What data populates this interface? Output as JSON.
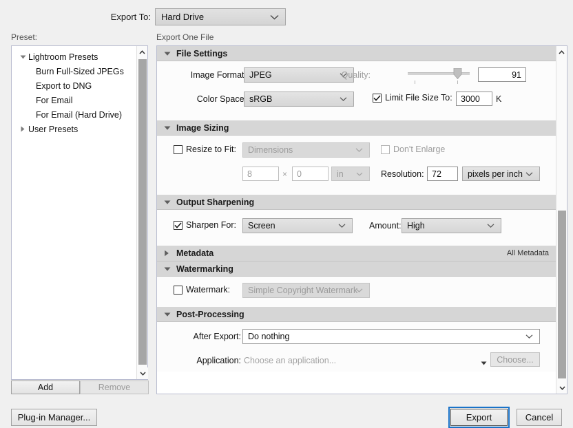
{
  "header": {
    "export_to_label": "Export To:",
    "export_to_value": "Hard Drive",
    "preset_label": "Preset:",
    "export_one_file": "Export One File"
  },
  "presets": {
    "tree": [
      {
        "label": "Lightroom Presets",
        "level": 0,
        "expanded": true
      },
      {
        "label": "Burn Full-Sized JPEGs",
        "level": 1,
        "expanded": null
      },
      {
        "label": "Export to DNG",
        "level": 1,
        "expanded": null
      },
      {
        "label": "For Email",
        "level": 1,
        "expanded": null
      },
      {
        "label": "For Email (Hard Drive)",
        "level": 1,
        "expanded": null
      },
      {
        "label": "User Presets",
        "level": 0,
        "expanded": false
      }
    ],
    "add_button": "Add",
    "remove_button": "Remove"
  },
  "sections": {
    "file_settings": {
      "title": "File Settings",
      "image_format_label": "Image Format:",
      "image_format_value": "JPEG",
      "color_space_label": "Color Space:",
      "color_space_value": "sRGB",
      "quality_label": "Quality:",
      "quality_value": "91",
      "quality_percent": 80,
      "limit_file_size_label": "Limit File Size To:",
      "limit_file_size_checked": true,
      "limit_file_size_value": "3000",
      "limit_file_size_unit": "K"
    },
    "image_sizing": {
      "title": "Image Sizing",
      "resize_to_fit_label": "Resize to Fit:",
      "resize_to_fit_checked": false,
      "resize_mode_value": "Dimensions",
      "dont_enlarge_label": "Don't Enlarge",
      "dont_enlarge_checked": false,
      "width_value": "8",
      "times_symbol": "×",
      "height_value": "0",
      "unit_value": "in",
      "resolution_label": "Resolution:",
      "resolution_value": "72",
      "resolution_unit_value": "pixels per inch"
    },
    "output_sharpening": {
      "title": "Output Sharpening",
      "sharpen_for_label": "Sharpen For:",
      "sharpen_for_checked": true,
      "sharpen_for_value": "Screen",
      "amount_label": "Amount:",
      "amount_value": "High"
    },
    "metadata": {
      "title": "Metadata",
      "expanded": false,
      "summary": "All Metadata"
    },
    "watermarking": {
      "title": "Watermarking",
      "watermark_label": "Watermark:",
      "watermark_checked": false,
      "watermark_value": "Simple Copyright Watermark"
    },
    "post_processing": {
      "title": "Post-Processing",
      "after_export_label": "After Export:",
      "after_export_value": "Do nothing",
      "application_label": "Application:",
      "application_placeholder": "Choose an application...",
      "choose_button": "Choose..."
    }
  },
  "footer": {
    "plugin_manager": "Plug-in Manager...",
    "export_button": "Export",
    "cancel_button": "Cancel"
  },
  "colors": {
    "focus_ring": "#1a73c8",
    "section_header_bg": "#d6d6d6",
    "window_bg": "#f0f0f0",
    "scroll_thumb": "#a6a6a6"
  }
}
